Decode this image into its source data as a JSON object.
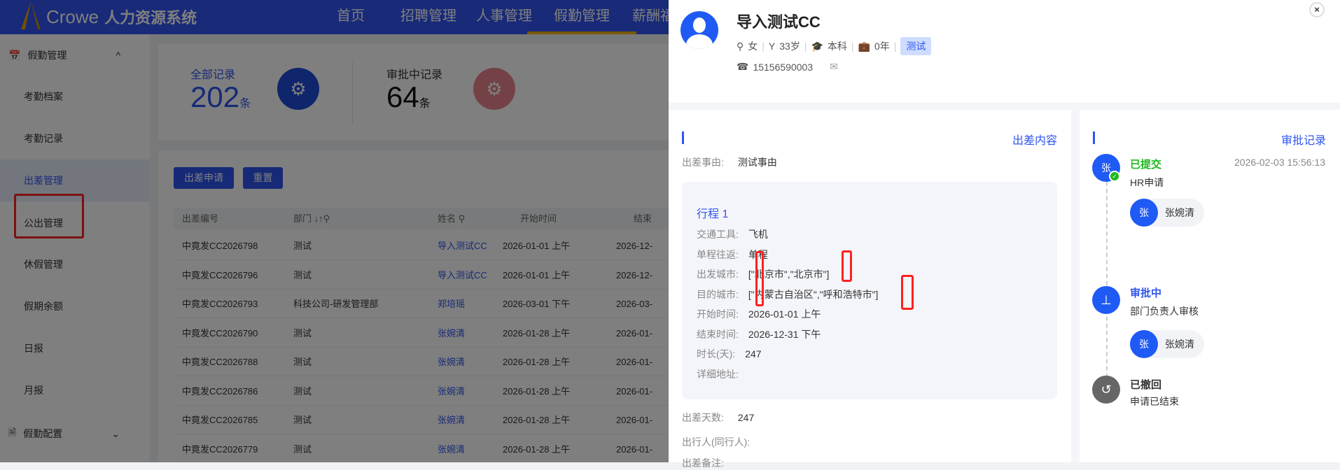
{
  "header": {
    "brand": "Crowe",
    "system": "人力资源系统",
    "nav": [
      "首页",
      "招聘管理",
      "人事管理",
      "假勤管理",
      "薪酬福利管"
    ],
    "active_nav": "假勤管理"
  },
  "sidebar": {
    "group1": "假勤管理",
    "items": [
      "考勤档案",
      "考勤记录",
      "出差管理",
      "公出管理",
      "休假管理",
      "假期余额",
      "日报",
      "月报"
    ],
    "active": "出差管理",
    "group2": "假勤配置"
  },
  "stats": {
    "all_label": "全部记录",
    "all_value": "202",
    "unit": "条",
    "pending_label": "审批中记录",
    "pending_value": "64"
  },
  "toolbar": {
    "apply": "出差申请",
    "reset": "重置"
  },
  "table": {
    "headers": [
      "出差编号",
      "部门",
      "姓名",
      "开始时间",
      "结束"
    ],
    "rows": [
      [
        "中竟发CC2026798",
        "测试",
        "导入测试CC",
        "2026-01-01 上午",
        "2026-12-"
      ],
      [
        "中竟发CC2026796",
        "测试",
        "导入测试CC",
        "2026-01-01 上午",
        "2026-12-"
      ],
      [
        "中竟发CC2026793",
        "科技公司-研发管理部",
        "郑培瑶",
        "2026-03-01 下午",
        "2026-03-"
      ],
      [
        "中竟发CC2026790",
        "测试",
        "张婉清",
        "2026-01-28 上午",
        "2026-01-"
      ],
      [
        "中竟发CC2026788",
        "测试",
        "张婉清",
        "2026-01-28 上午",
        "2026-01-"
      ],
      [
        "中竟发CC2026786",
        "测试",
        "张婉清",
        "2026-01-28 上午",
        "2026-01-"
      ],
      [
        "中竟发CC2026785",
        "测试",
        "张婉清",
        "2026-01-28 上午",
        "2026-01-"
      ],
      [
        "中竟发CC2026779",
        "测试",
        "张婉清",
        "2026-01-28 上午",
        "2026-01-"
      ]
    ]
  },
  "profile": {
    "name": "导入测试CC",
    "gender": "女",
    "age": "33岁",
    "education": "本科",
    "years": "0年",
    "tag": "测试",
    "phone": "15156590003"
  },
  "trip": {
    "section_title": "出差内容",
    "reason_label": "出差事由:",
    "reason": "测试事由",
    "itinerary_title": "行程 1",
    "fields": [
      [
        "交通工具:",
        "飞机"
      ],
      [
        "单程往返:",
        "单程"
      ],
      [
        "出发城市:",
        "[\"北京市\",\"北京市\"]"
      ],
      [
        "目的城市:",
        "[\"内蒙古自治区\",\"呼和浩特市\"]"
      ],
      [
        "开始时间:",
        "2026-01-01 上午"
      ],
      [
        "结束时间:",
        "2026-12-31 下午"
      ],
      [
        "时长(天):",
        "247"
      ],
      [
        "详细地址:",
        ""
      ]
    ],
    "days_label": "出差天数:",
    "days": "247",
    "companions_label": "出行人(同行人):",
    "remark_label": "出差备注:"
  },
  "approval": {
    "section_title": "审批记录",
    "steps": [
      {
        "status": "已提交",
        "desc": "HR申请",
        "time": "2026-02-03 15:56:13",
        "avatar": "张",
        "person": "张婉清",
        "color": "#1ab91a"
      },
      {
        "status": "审批中",
        "desc": "部门负责人审核",
        "avatar": "张",
        "person": "张婉清",
        "color": "#2f55ee"
      },
      {
        "status": "已撤回",
        "desc": "申请已结束",
        "color": "#333333"
      }
    ]
  }
}
